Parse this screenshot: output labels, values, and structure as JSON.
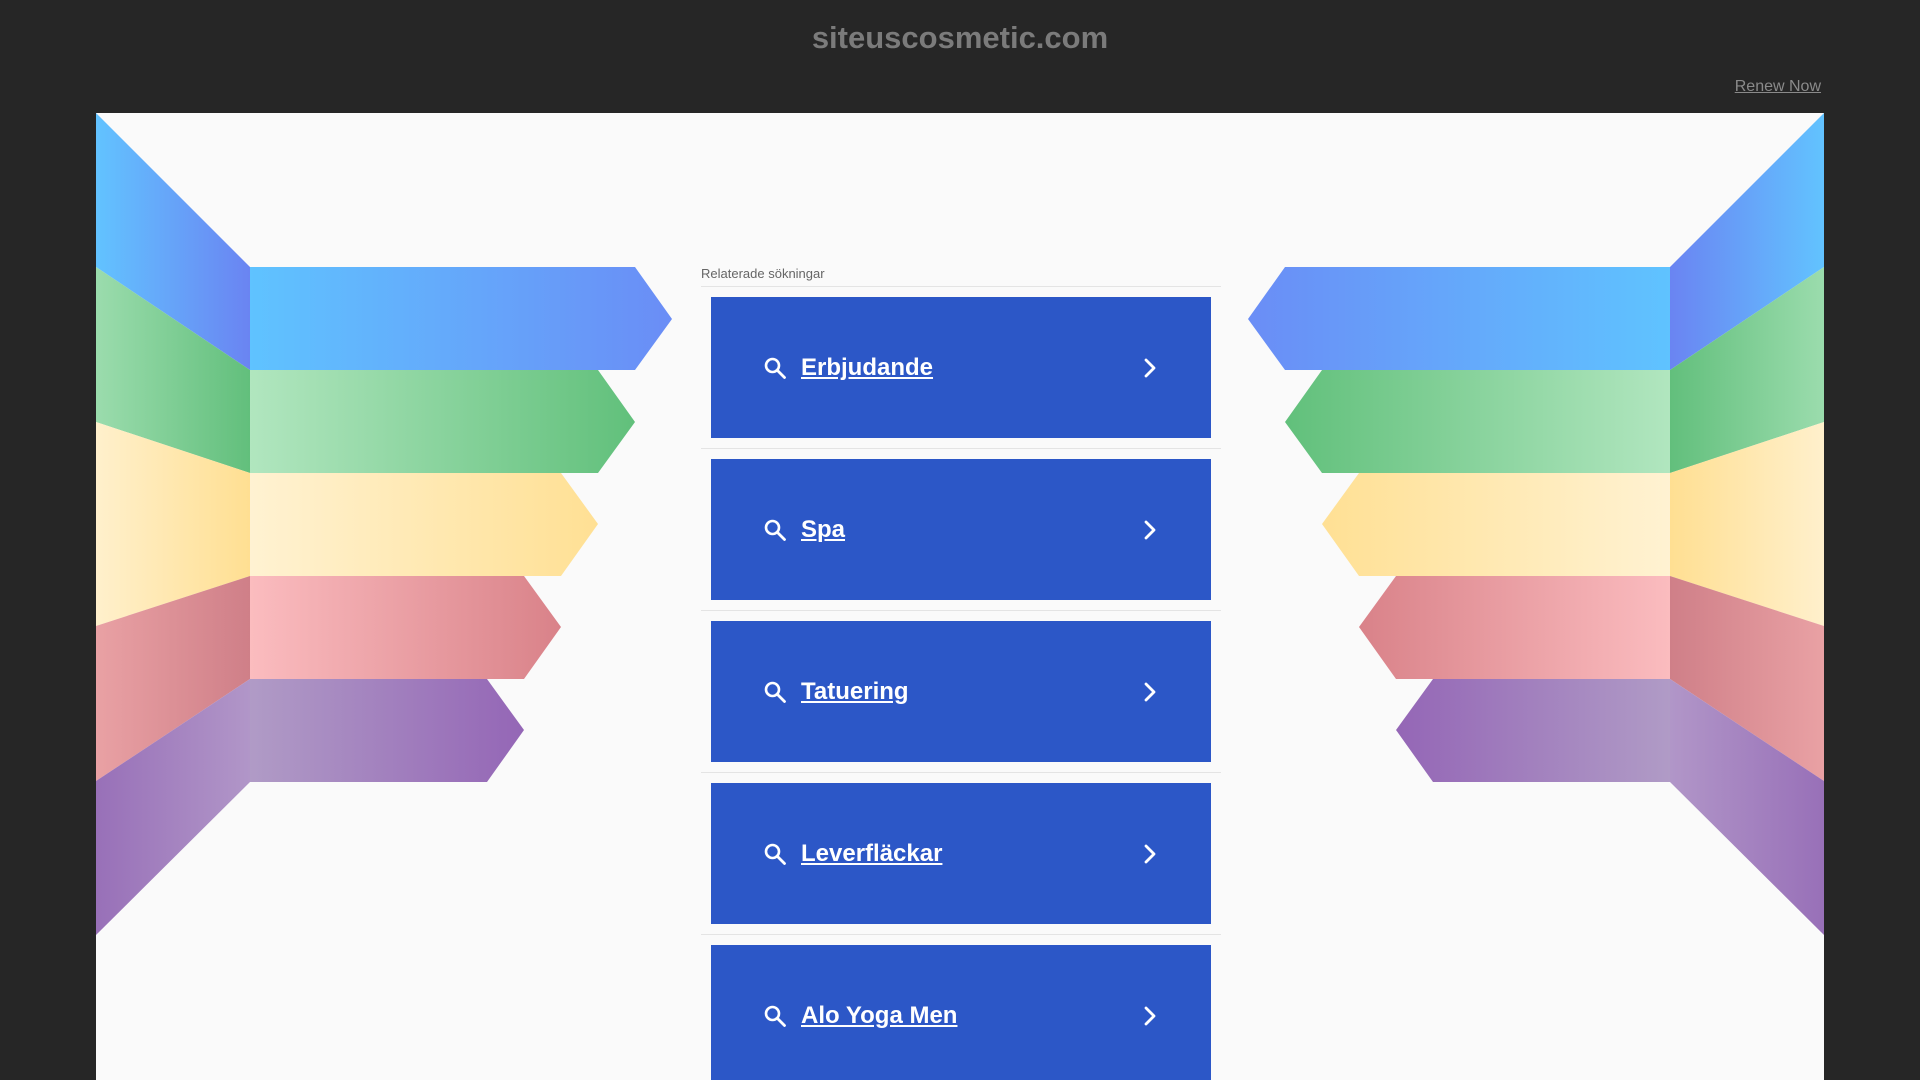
{
  "header": {
    "domain": "siteuscosmetic.com",
    "renew_label": "Renew Now"
  },
  "related": {
    "title": "Relaterade sökningar",
    "items": [
      {
        "label": "Erbjudande",
        "icon": "search-icon",
        "arrow": "chevron-right-icon"
      },
      {
        "label": "Spa",
        "icon": "search-icon",
        "arrow": "chevron-right-icon"
      },
      {
        "label": "Tatuering",
        "icon": "search-icon",
        "arrow": "chevron-right-icon"
      },
      {
        "label": "Leverfläckar",
        "icon": "search-icon",
        "arrow": "chevron-right-icon"
      },
      {
        "label": "Alo Yoga Men",
        "icon": "search-icon",
        "arrow": "chevron-right-icon"
      }
    ]
  },
  "colors": {
    "background": "#262626",
    "panel": "#fafafa",
    "button": "#2c57c7",
    "stripe_blue": "#5b8df8",
    "stripe_green": "#6cc482",
    "stripe_yellow": "#ffe39a",
    "stripe_red": "#e4888f",
    "stripe_purple": "#9a6db5"
  }
}
